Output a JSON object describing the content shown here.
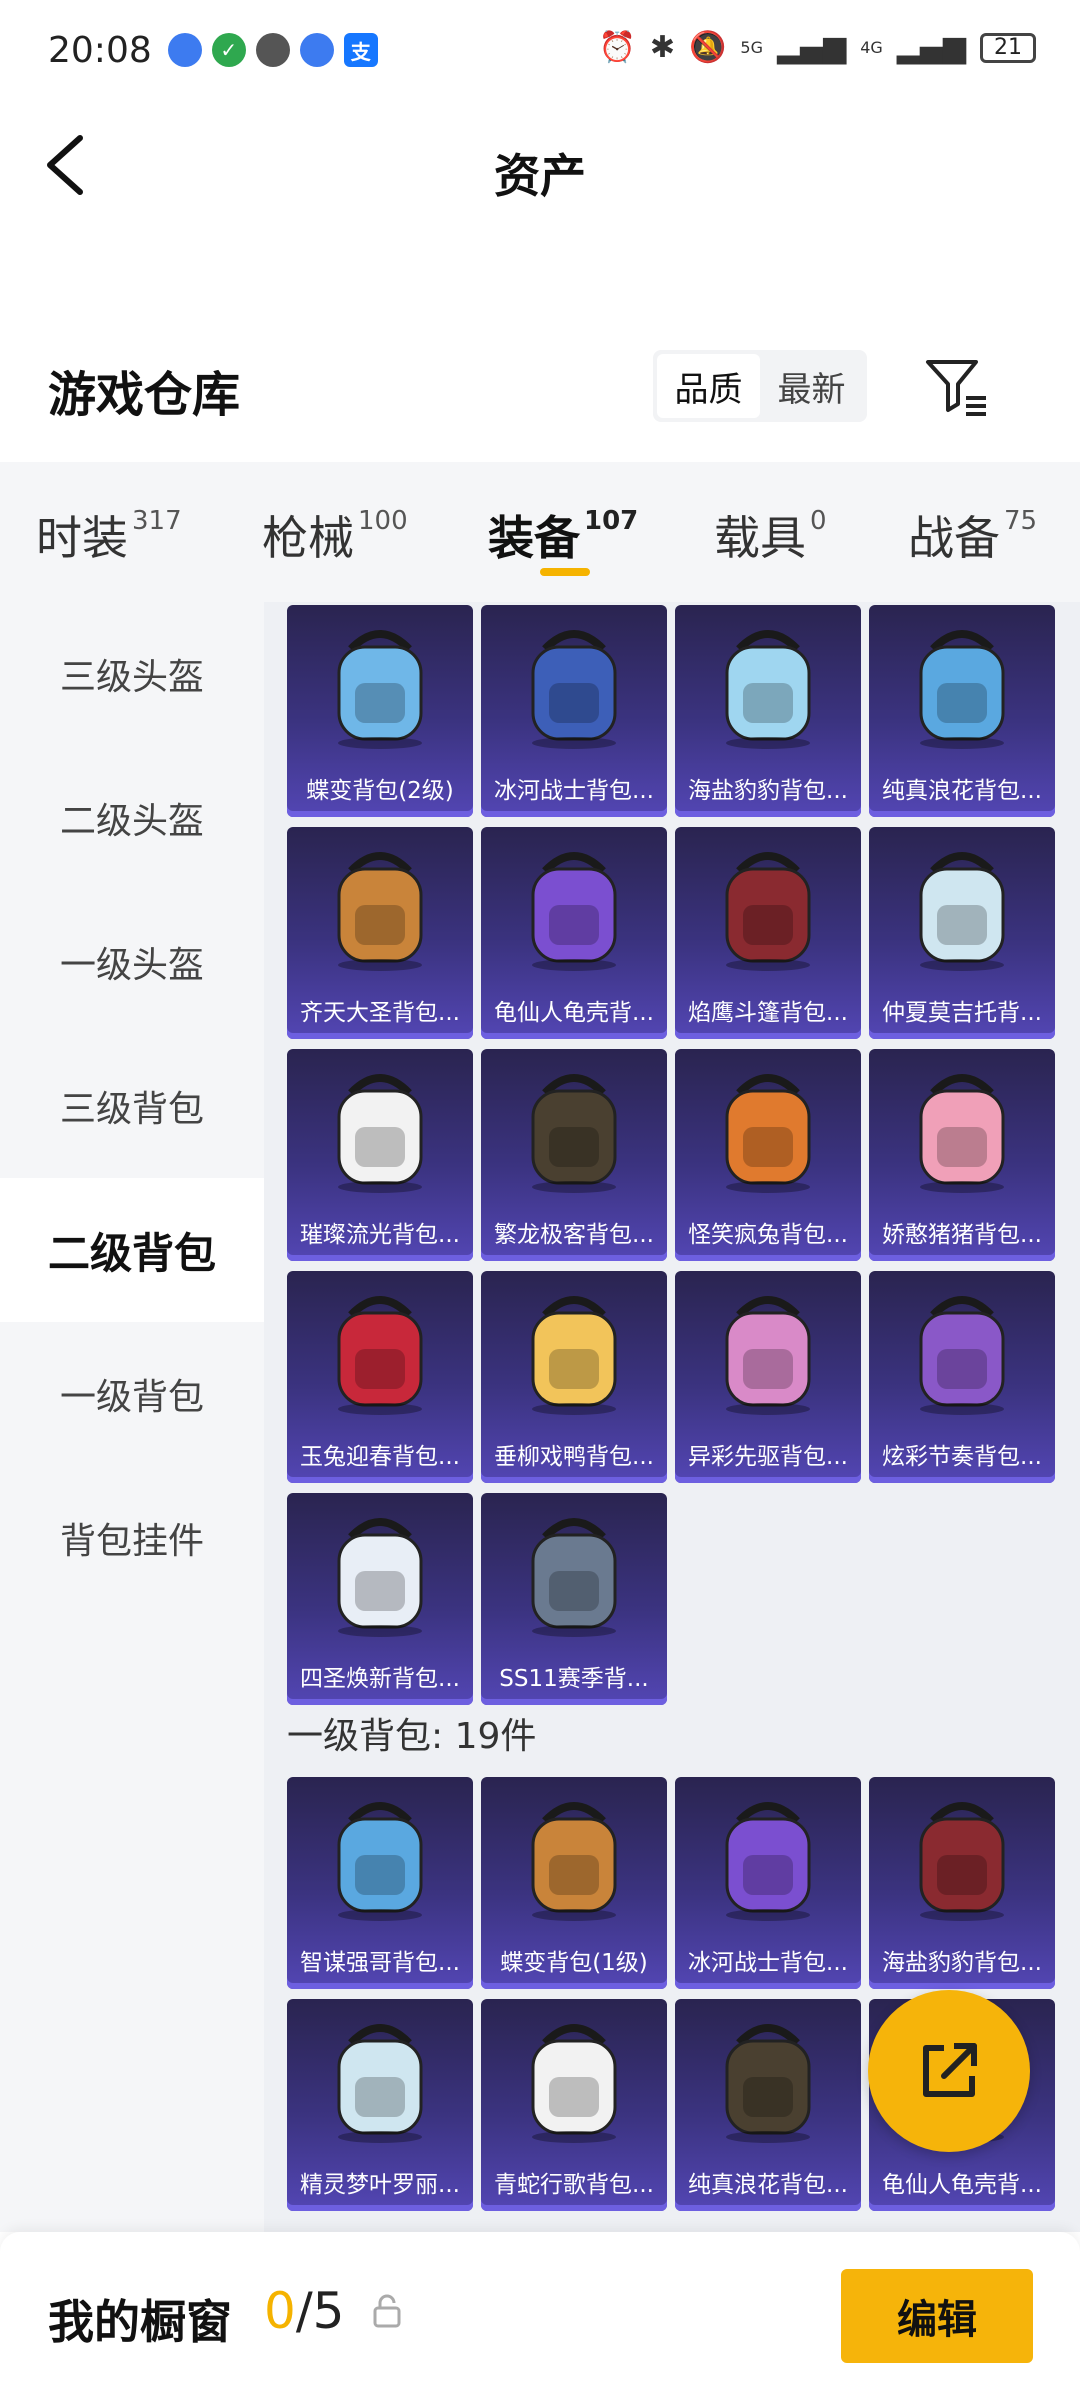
{
  "status_bar": {
    "time": "20:08",
    "signal_1": "5G",
    "signal_2": "4G",
    "battery": "21"
  },
  "header": {
    "title": "资产"
  },
  "warehouse": {
    "title": "游戏仓库",
    "sort_quality": "品质",
    "sort_latest": "最新"
  },
  "tabs": [
    {
      "label": "时装",
      "count": "317"
    },
    {
      "label": "枪械",
      "count": "100"
    },
    {
      "label": "装备",
      "count": "107"
    },
    {
      "label": "载具",
      "count": "0"
    },
    {
      "label": "战备",
      "count": "75"
    }
  ],
  "sidebar": [
    "三级头盔",
    "二级头盔",
    "一级头盔",
    "三级背包",
    "二级背包",
    "一级背包",
    "背包挂件"
  ],
  "level2_items": [
    "蝶变背包(2级)",
    "冰河战士背包...",
    "海盐豹豹背包...",
    "纯真浪花背包...",
    "齐天大圣背包...",
    "龟仙人龟壳背...",
    "焰鹰斗篷背包...",
    "仲夏莫吉托背...",
    "璀璨流光背包...",
    "繁龙极客背包...",
    "怪笑疯兔背包...",
    "娇憨猪猪背包...",
    "玉兔迎春背包...",
    "垂柳戏鸭背包...",
    "异彩先驱背包...",
    "炫彩节奏背包...",
    "四圣焕新背包...",
    "SS11赛季背..."
  ],
  "level1_section": "一级背包: 19件",
  "level1_items": [
    "智谋强哥背包...",
    "蝶变背包(1级)",
    "冰河战士背包...",
    "海盐豹豹背包...",
    "精灵梦叶罗丽...",
    "青蛇行歌背包...",
    "纯真浪花背包...",
    "龟仙人龟壳背..."
  ],
  "bottom": {
    "title": "我的橱窗",
    "current": "0",
    "total": "/5",
    "edit": "编辑"
  },
  "colors": {
    "accent": "#f6b40a",
    "card_top": "#2a2450",
    "card_bottom": "#5346b4"
  }
}
